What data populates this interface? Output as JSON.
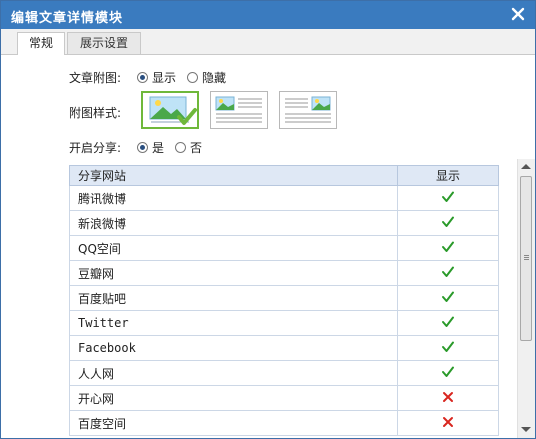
{
  "dialog": {
    "title": "编辑文章详情模块",
    "close_icon": "close-icon"
  },
  "tabs": [
    {
      "label": "常规",
      "active": true
    },
    {
      "label": "展示设置",
      "active": false
    }
  ],
  "image_toggle": {
    "label": "文章附图:",
    "options": [
      {
        "label": "显示",
        "checked": true
      },
      {
        "label": "隐藏",
        "checked": false
      }
    ]
  },
  "image_style": {
    "label": "附图样式:",
    "options": [
      {
        "name": "image-large",
        "selected": true
      },
      {
        "name": "image-left-text",
        "selected": false
      },
      {
        "name": "image-right-text",
        "selected": false
      }
    ]
  },
  "share_toggle": {
    "label": "开启分享:",
    "options": [
      {
        "label": "是",
        "checked": true
      },
      {
        "label": "否",
        "checked": false
      }
    ]
  },
  "share_table": {
    "headers": [
      "分享网站",
      "显示"
    ],
    "rows": [
      {
        "site": "腾讯微博",
        "show": true
      },
      {
        "site": "新浪微博",
        "show": true
      },
      {
        "site": "QQ空间",
        "show": true
      },
      {
        "site": "豆瓣网",
        "show": true
      },
      {
        "site": "百度贴吧",
        "show": true
      },
      {
        "site": "Twitter",
        "show": true
      },
      {
        "site": "Facebook",
        "show": true
      },
      {
        "site": "人人网",
        "show": true
      },
      {
        "site": "开心网",
        "show": false
      },
      {
        "site": "百度空间",
        "show": false
      }
    ]
  },
  "colors": {
    "titlebar": "#3a7bbf",
    "check": "#2a9a2a",
    "cross": "#d8261f",
    "selected_border": "#6fb83a"
  }
}
